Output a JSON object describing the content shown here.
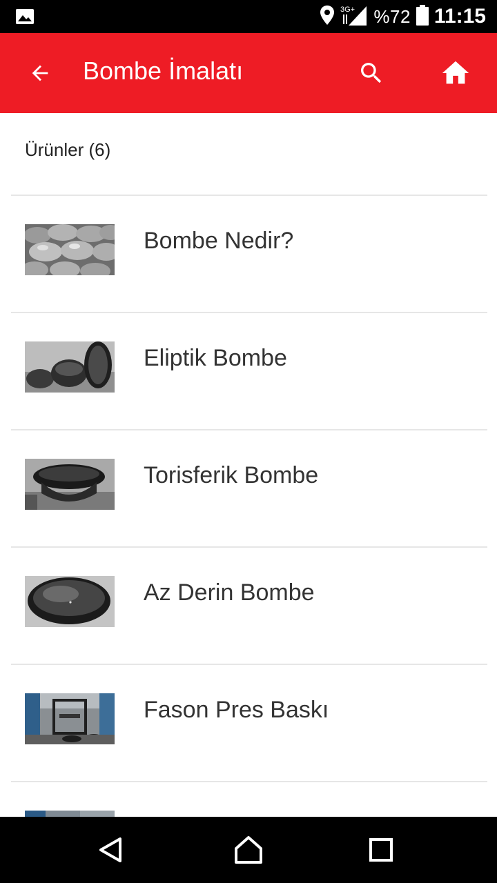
{
  "status_bar": {
    "network_label": "3G+",
    "battery": "%72",
    "time": "11:15"
  },
  "app_bar": {
    "title": "Bombe İmalatı",
    "icons": [
      "arrow-back-icon",
      "search-icon",
      "home-icon"
    ]
  },
  "section": {
    "header": "Ürünler (6)"
  },
  "products": [
    {
      "label": "Bombe Nedir?"
    },
    {
      "label": "Eliptik Bombe"
    },
    {
      "label": "Torisferik Bombe"
    },
    {
      "label": "Az Derin Bombe"
    },
    {
      "label": "Fason Pres Baskı"
    },
    {
      "label": ""
    }
  ],
  "nav_bar": {
    "icons": [
      "nav-back-icon",
      "nav-home-icon",
      "nav-recents-icon"
    ]
  },
  "colors": {
    "accent": "#ee1c25",
    "divider": "#e6e6e6",
    "text": "#333333"
  }
}
